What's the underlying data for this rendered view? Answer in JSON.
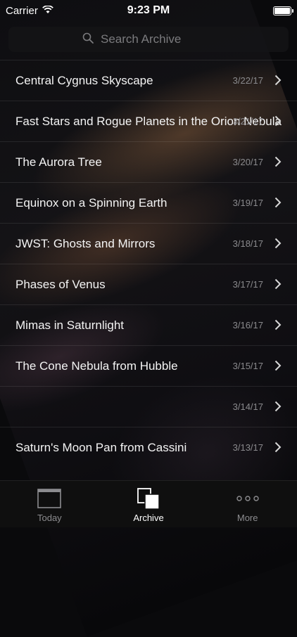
{
  "status_bar": {
    "carrier": "Carrier",
    "time": "9:23 PM"
  },
  "search": {
    "placeholder": "Search Archive"
  },
  "archive": {
    "items": [
      {
        "title": "Central Cygnus Skyscape",
        "date": "3/22/17"
      },
      {
        "title": "Fast Stars and Rogue Planets in the Orion Nebula",
        "date": "3/21/17"
      },
      {
        "title": "The Aurora Tree",
        "date": "3/20/17"
      },
      {
        "title": "Equinox on a Spinning Earth",
        "date": "3/19/17"
      },
      {
        "title": "JWST: Ghosts and Mirrors",
        "date": "3/18/17"
      },
      {
        "title": "Phases of Venus",
        "date": "3/17/17"
      },
      {
        "title": "Mimas in Saturnlight",
        "date": "3/16/17"
      },
      {
        "title": "The Cone Nebula from Hubble",
        "date": "3/15/17"
      },
      {
        "title": "",
        "date": "3/14/17"
      },
      {
        "title": "Saturn's Moon Pan from Cassini",
        "date": "3/13/17"
      }
    ]
  },
  "tabbar": {
    "tabs": [
      {
        "label": "Today",
        "icon": "today-icon"
      },
      {
        "label": "Archive",
        "icon": "archive-icon"
      },
      {
        "label": "More",
        "icon": "more-icon"
      }
    ],
    "active_index": 1
  },
  "colors": {
    "active_tab": "#ffffff",
    "inactive_tab": "#8c8c8f",
    "date_text": "#8a8a8d"
  }
}
